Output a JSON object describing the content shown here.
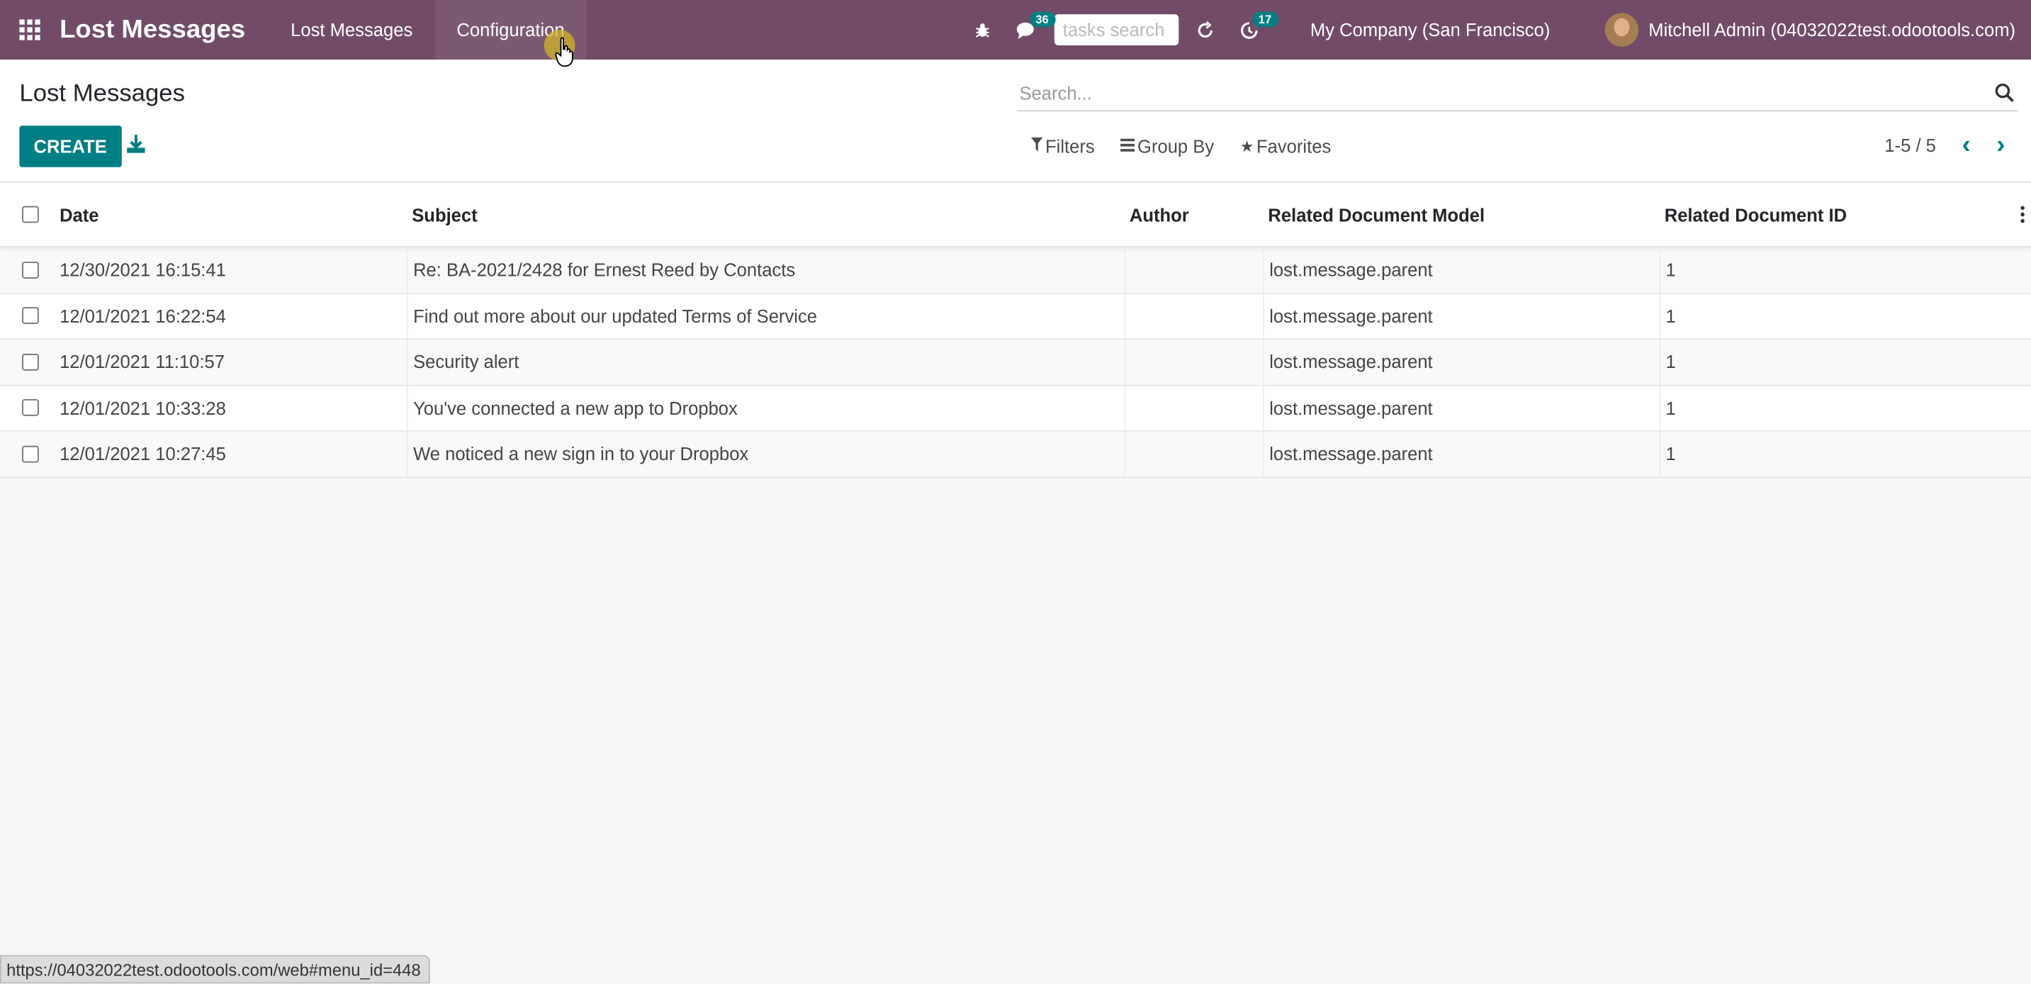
{
  "navbar": {
    "app_title": "Lost Messages",
    "menu": [
      "Lost Messages",
      "Configuration"
    ],
    "messages_badge": "36",
    "activity_badge": "17",
    "tasks_search_placeholder": "tasks search",
    "company": "My Company (San Francisco)",
    "user": "Mitchell Admin (04032022test.odootools.com)",
    "colors": {
      "navbar_bg": "#714b67",
      "accent": "#017e84"
    }
  },
  "control_panel": {
    "breadcrumb": "Lost Messages",
    "create_label": "CREATE",
    "search_placeholder": "Search...",
    "filters_label": "Filters",
    "group_by_label": "Group By",
    "favorites_label": "Favorites",
    "pager": "1-5 / 5"
  },
  "table": {
    "columns": [
      "Date",
      "Subject",
      "Author",
      "Related Document Model",
      "Related Document ID"
    ],
    "rows": [
      {
        "date": "12/30/2021 16:15:41",
        "subject": "Re: BA-2021/2428 for Ernest Reed by Contacts",
        "author": "",
        "model": "lost.message.parent",
        "id": "1"
      },
      {
        "date": "12/01/2021 16:22:54",
        "subject": "Find out more about our updated Terms of Service",
        "author": "",
        "model": "lost.message.parent",
        "id": "1"
      },
      {
        "date": "12/01/2021 11:10:57",
        "subject": "Security alert",
        "author": "",
        "model": "lost.message.parent",
        "id": "1"
      },
      {
        "date": "12/01/2021 10:33:28",
        "subject": "You've connected a new app to Dropbox",
        "author": "",
        "model": "lost.message.parent",
        "id": "1"
      },
      {
        "date": "12/01/2021 10:27:45",
        "subject": "We noticed a new sign in to your Dropbox",
        "author": "",
        "model": "lost.message.parent",
        "id": "1"
      }
    ]
  },
  "statusbar": {
    "url": "https://04032022test.odootools.com/web#menu_id=448"
  }
}
